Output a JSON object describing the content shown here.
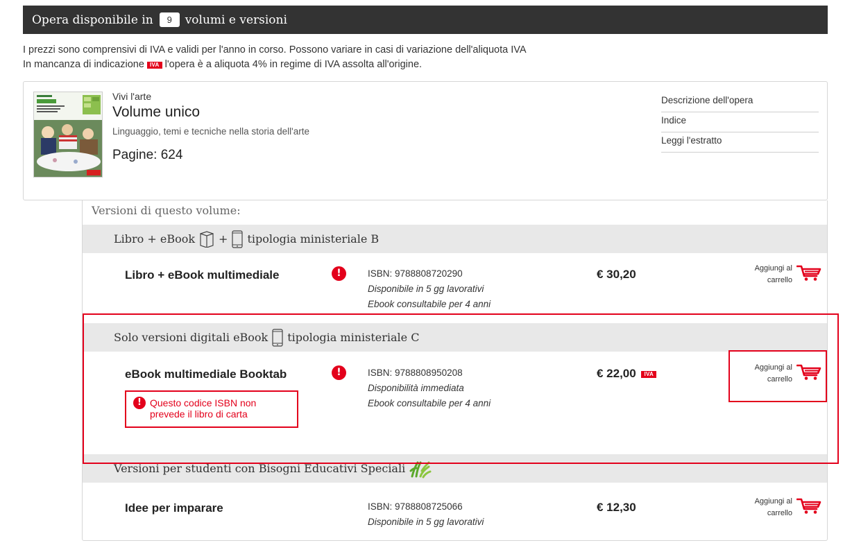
{
  "header": {
    "title_prefix": "Opera disponibile in",
    "count": "9",
    "title_suffix": "volumi e versioni"
  },
  "intro": {
    "line1": "I prezzi sono comprensivi di IVA e validi per l'anno in corso. Possono variare in casi di variazione dell'aliquota IVA",
    "line2_prefix": "In mancanza di indicazione",
    "iva_tag": "IVA",
    "line2_suffix": "l'opera è a aliquota 4% in regime di IVA assolta all'origine."
  },
  "volume": {
    "series": "Vivi l'arte",
    "title": "Volume unico",
    "subtitle": "Linguaggio, temi e tecniche nella storia dell'arte",
    "pages": "Pagine: 624",
    "links": [
      "Descrizione dell'opera",
      "Indice",
      "Leggi l'estratto"
    ]
  },
  "versions": {
    "heading": "Versioni di questo volume:",
    "cart_line1": "Aggiungi al",
    "cart_line2": "carrello",
    "groups": [
      {
        "label_prefix": "Libro + eBook",
        "label_plus": "+",
        "label_suffix": "tipologia ministeriale B",
        "items": [
          {
            "name": "Libro + eBook multimediale",
            "isbn": "ISBN: 9788808720290",
            "availability": "Disponibile in 5 gg lavorativi",
            "ebook_note": "Ebook consultabile per 4 anni",
            "price": "€ 30,20"
          }
        ]
      },
      {
        "label_prefix": "Solo versioni digitali eBook",
        "label_suffix": "tipologia ministeriale C",
        "items": [
          {
            "name": "eBook multimediale Booktab",
            "isbn": "ISBN: 9788808950208",
            "availability": "Disponibilità immediata",
            "ebook_note": "Ebook consultabile per 4 anni",
            "price": "€ 22,00",
            "price_tag": "IVA",
            "warning": "Questo codice ISBN non prevede il libro di carta"
          }
        ]
      },
      {
        "label_prefix": "Versioni per studenti con Bisogni Educativi Speciali",
        "items": [
          {
            "name": "Idee per imparare",
            "isbn": "ISBN: 9788808725066",
            "availability": "Disponibile in 5 gg lavorativi",
            "price": "€ 12,30"
          }
        ]
      }
    ]
  },
  "colors": {
    "accent_red": "#e3001b",
    "header_bg": "#333333",
    "group_bg": "#e8e8e8"
  },
  "icons": [
    "info-icon",
    "cart-icon",
    "book-icon",
    "tablet-icon",
    "hands-icon",
    "warning-icon"
  ]
}
